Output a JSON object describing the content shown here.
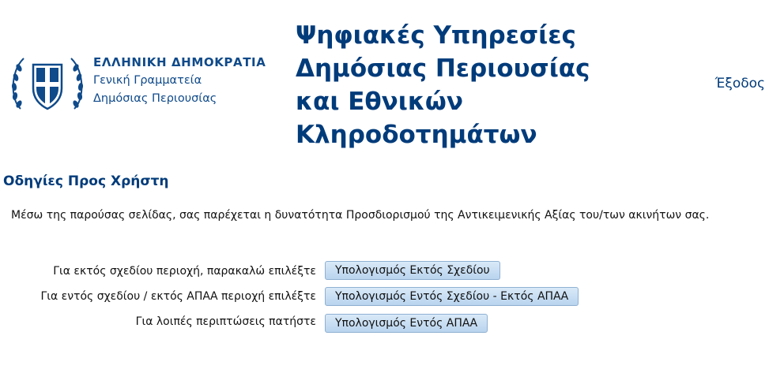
{
  "header": {
    "gov_name": "ΕΛΛΗΝΙΚΗ ΔΗΜΟΚΡΑΤΙΑ",
    "gov_sub1": "Γενική Γραμματεία",
    "gov_sub2": "Δημόσιας Περιουσίας",
    "site_title": "Ψηφιακές Υπηρεσίες Δημόσιας Περιουσίας και Εθνικών Κληροδοτημάτων",
    "logout": "Έξοδος",
    "emblem_icon": "greek-coat-of-arms-icon"
  },
  "main": {
    "section_title": "Οδηγίες Προς Χρήστη",
    "intro": "Μέσω της παρούσας σελίδας, σας παρέχεται η δυνατότητα Προσδιορισμού της Αντικειμενικής Αξίας του/των ακινήτων σας.",
    "options": [
      {
        "label": "Για εκτός σχεδίου περιοχή, παρακαλώ επιλέξτε",
        "button": "Υπολογισμός Εκτός Σχεδίου"
      },
      {
        "label": "Για εντός σχεδίου / εκτός ΑΠΑΑ περιοχή επιλέξτε",
        "button": "Υπολογισμός Εντός Σχεδίου - Εκτός ΑΠΑΑ"
      },
      {
        "label": "Για λοιπές περιπτώσεις πατήστε",
        "button": "Υπολογισμός Εντός ΑΠΑΑ"
      }
    ]
  },
  "colors": {
    "brand_blue": "#003b7a",
    "logo_blue": "#0f4a8a",
    "button_bg": "#c9def3",
    "button_border": "#8fb0d2"
  }
}
